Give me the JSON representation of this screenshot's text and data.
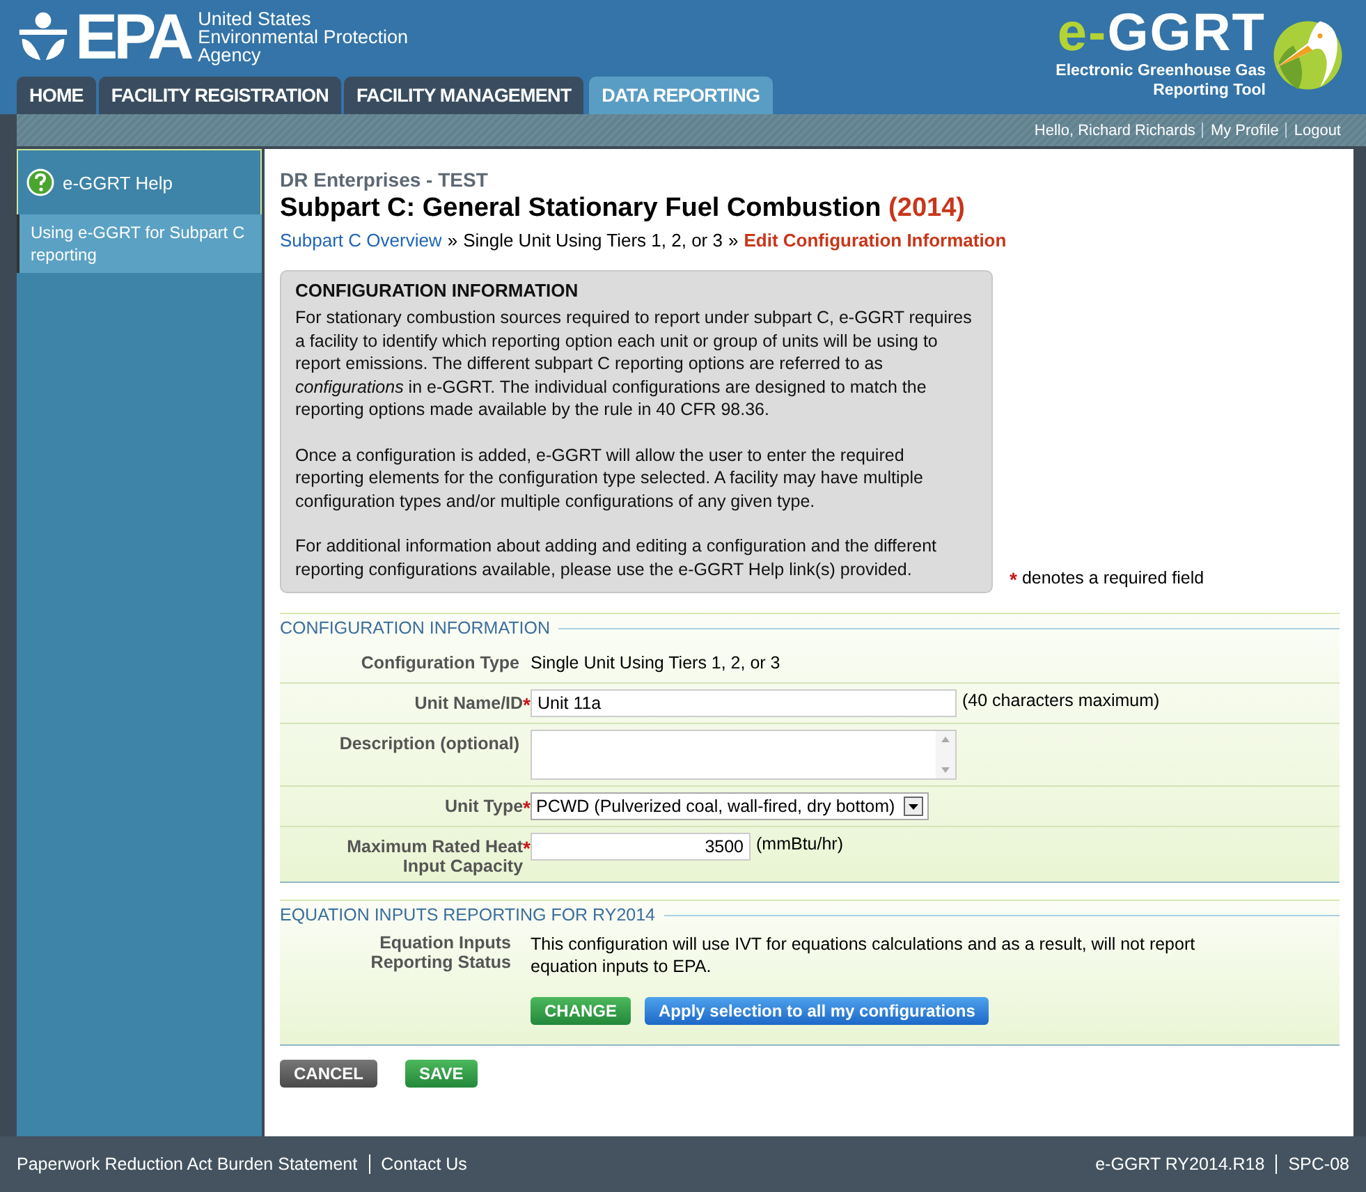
{
  "header": {
    "logo": {
      "mark": "EPA",
      "lines": [
        "United States",
        "Environmental Protection",
        "Agency"
      ]
    },
    "tool_logo": {
      "prefix": "e-",
      "name": "GGRT",
      "subtitle": [
        "Electronic Greenhouse Gas",
        "Reporting Tool"
      ]
    }
  },
  "tabs": [
    {
      "label": "HOME",
      "selected": false
    },
    {
      "label": "FACILITY REGISTRATION",
      "selected": false
    },
    {
      "label": "FACILITY MANAGEMENT",
      "selected": false
    },
    {
      "label": "DATA REPORTING",
      "selected": true
    }
  ],
  "user_links": [
    {
      "label": "Hello, Richard Richards"
    },
    {
      "label": "My Profile"
    },
    {
      "label": "Logout"
    }
  ],
  "sidebar": {
    "help_title": "e-GGRT Help",
    "items": [
      {
        "label": "Using e-GGRT for Subpart C reporting"
      }
    ]
  },
  "page": {
    "facility": "DR Enterprises - TEST",
    "title": "Subpart C: General Stationary Fuel Combustion",
    "year": "(2014)",
    "breadcrumb": [
      {
        "text": "Subpart C Overview",
        "kind": "link"
      },
      {
        "text": "»",
        "kind": "sep"
      },
      {
        "text": "Single Unit Using Tiers 1, 2, or 3",
        "kind": "plain"
      },
      {
        "text": "»",
        "kind": "sep"
      },
      {
        "text": "Edit Configuration Information",
        "kind": "current"
      }
    ]
  },
  "info_box": {
    "heading": "CONFIGURATION INFORMATION",
    "paragraphs": [
      "For stationary combustion sources required to report under subpart C, e-GGRT requires a facility to identify which reporting option each unit or group of units will be using to report emissions. The different subpart C reporting options are referred to as *configurations* in e-GGRT. The individual configurations are designed to match the reporting options made available by the rule in 40 CFR 98.36.",
      "Once a configuration is added, e-GGRT will allow the user to enter the required reporting elements for the configuration type selected. A facility may have multiple configuration types and/or multiple configurations of any given type.",
      "For additional information about adding and editing a configuration and the different reporting configurations available, please use the e-GGRT Help link(s) provided."
    ]
  },
  "required_note": {
    "mark": "*",
    "text": "denotes a required field"
  },
  "config_section": {
    "title": "CONFIGURATION INFORMATION",
    "fields": [
      {
        "label": "Configuration Type",
        "kind": "text",
        "required": false,
        "value": "Single Unit Using Tiers 1, 2, or 3"
      },
      {
        "label": "Unit Name/ID",
        "kind": "input",
        "required": true,
        "value": "Unit 11a",
        "hint": "(40 characters maximum)"
      },
      {
        "label": "Description (optional)",
        "kind": "textarea",
        "required": false
      },
      {
        "label": "Unit Type",
        "kind": "select",
        "required": true,
        "value": "PCWD (Pulverized coal, wall-fired, dry bottom)"
      },
      {
        "label": "Maximum Rated Heat Input Capacity",
        "kind": "number",
        "required": true,
        "value": "3500",
        "hint": "(mmBtu/hr)"
      }
    ]
  },
  "equation_section": {
    "title": "EQUATION INPUTS REPORTING FOR RY2014",
    "label": "Equation Inputs Reporting Status",
    "text": "This configuration will use IVT for equations calculations and as a result, will not report equation inputs to EPA.",
    "buttons": [
      {
        "label": "CHANGE",
        "kind": "green"
      },
      {
        "label": "Apply selection to all my configurations",
        "kind": "blue"
      }
    ]
  },
  "actions": [
    {
      "label": "CANCEL",
      "kind": "gray"
    },
    {
      "label": "SAVE",
      "kind": "green"
    }
  ],
  "footer": {
    "left": [
      "Paperwork Reduction Act Burden Statement",
      "Contact Us"
    ],
    "right": [
      "e-GGRT RY2014.R18",
      "SPC-08"
    ]
  }
}
